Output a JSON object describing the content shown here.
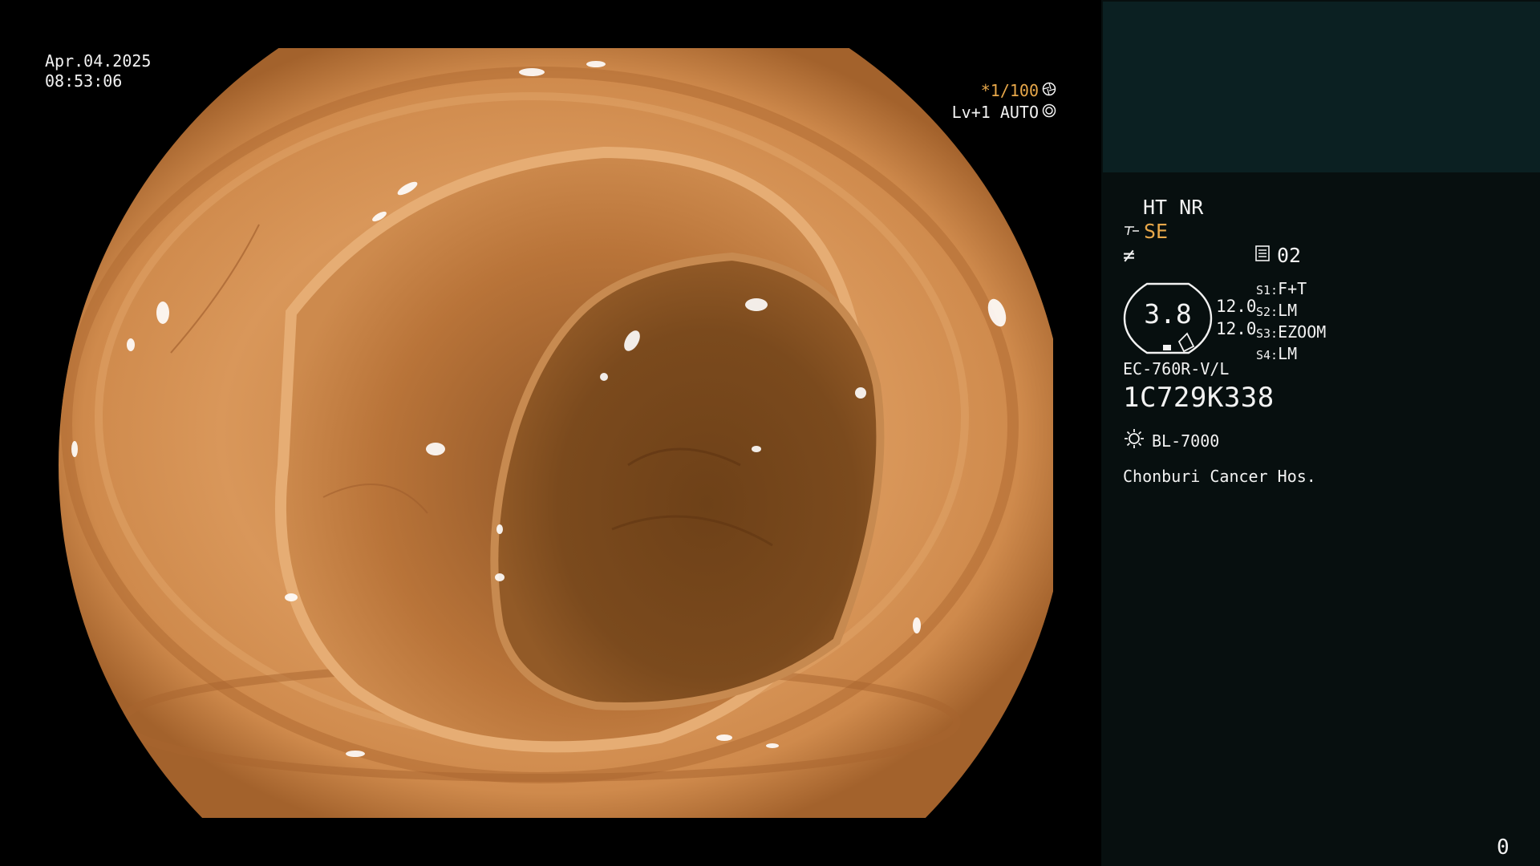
{
  "overlay": {
    "date": "Apr.04.2025",
    "time": "08:53:06",
    "shutter": "*1/100",
    "shutter_icon": "shutter-icon",
    "level": "Lv+1 AUTO",
    "level_icon": "iris-icon"
  },
  "panel": {
    "ht_nr": "HT NR",
    "se_label": "SE",
    "se_icon": "structure-enhance-icon",
    "f_icon_glyph": "≠",
    "memo_icon": "memory-card-icon",
    "memo_value": "02",
    "gauge_value": "3.8",
    "value_top": "12.0",
    "value_bottom": "12.0",
    "switches": [
      {
        "key": "S1:",
        "value": "F+T"
      },
      {
        "key": "S2:",
        "value": "LM"
      },
      {
        "key": "S3:",
        "value": "EZOOM"
      },
      {
        "key": "S4:",
        "value": "LM"
      }
    ],
    "scope_model": "EC-760R-V/L",
    "serial": "1C729K338",
    "light_icon": "sun-icon",
    "light_source": "BL-7000",
    "hospital": "Chonburi Cancer Hos.",
    "counter": "0"
  },
  "colors": {
    "accent": "#e8a84a",
    "panel_bg": "#070f0f",
    "thumb_bg": "#0b2022",
    "tissue_light": "#d99557",
    "tissue_dark": "#5a3010"
  }
}
